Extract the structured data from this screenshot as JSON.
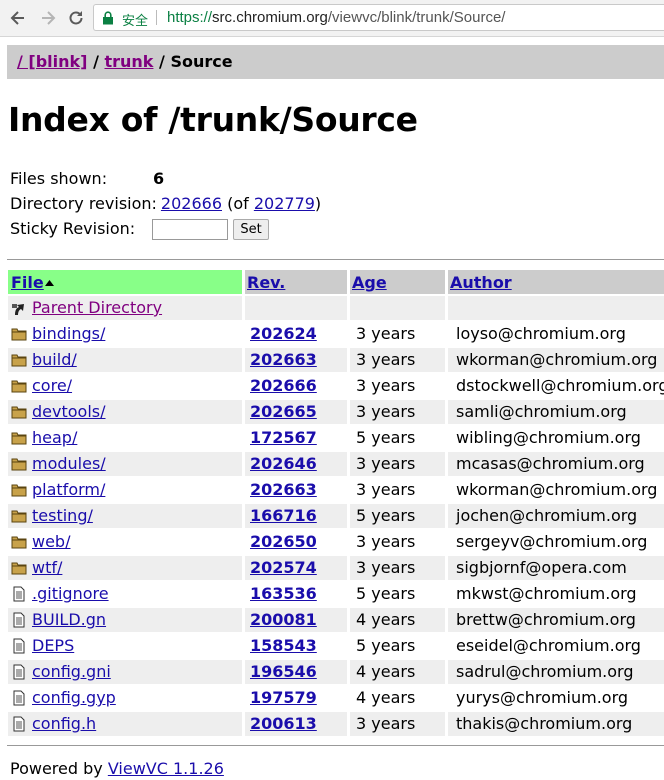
{
  "browser": {
    "secure_label": "安全",
    "url_scheme": "https://",
    "url_host": "src.chromium.org",
    "url_path": "/viewvc/blink/trunk/Source/"
  },
  "breadcrumb": {
    "root_label": "/ [blink]",
    "sep1": " / ",
    "trunk_label": "trunk",
    "sep2": " / ",
    "current": "Source"
  },
  "page_title": "Index of /trunk/Source",
  "info": {
    "files_shown_label": "Files shown:",
    "files_shown_value": "6",
    "dir_revision_label": "Directory revision:",
    "dir_revision": "202666",
    "of_open": " (of ",
    "head_revision": "202779",
    "of_close": ")",
    "sticky_label": "Sticky Revision:",
    "sticky_value": "",
    "set_button": "Set"
  },
  "table": {
    "headers": {
      "file": "File",
      "rev": "Rev.",
      "age": "Age",
      "author": "Author"
    },
    "parent_label": " Parent Directory",
    "rows": [
      {
        "name": " bindings/",
        "type": "dir",
        "rev": "202624",
        "age": "3 years",
        "author": "loyso@chromium.org"
      },
      {
        "name": " build/",
        "type": "dir",
        "rev": "202663",
        "age": "3 years",
        "author": "wkorman@chromium.org"
      },
      {
        "name": " core/",
        "type": "dir",
        "rev": "202666",
        "age": "3 years",
        "author": "dstockwell@chromium.org"
      },
      {
        "name": " devtools/",
        "type": "dir",
        "rev": "202665",
        "age": "3 years",
        "author": "samli@chromium.org"
      },
      {
        "name": " heap/",
        "type": "dir",
        "rev": "172567",
        "age": "5 years",
        "author": "wibling@chromium.org"
      },
      {
        "name": " modules/",
        "type": "dir",
        "rev": "202646",
        "age": "3 years",
        "author": "mcasas@chromium.org"
      },
      {
        "name": " platform/",
        "type": "dir",
        "rev": "202663",
        "age": "3 years",
        "author": "wkorman@chromium.org"
      },
      {
        "name": " testing/",
        "type": "dir",
        "rev": "166716",
        "age": "5 years",
        "author": "jochen@chromium.org"
      },
      {
        "name": " web/",
        "type": "dir",
        "rev": "202650",
        "age": "3 years",
        "author": "sergeyv@chromium.org"
      },
      {
        "name": " wtf/",
        "type": "dir",
        "rev": "202574",
        "age": "3 years",
        "author": "sigbjornf@opera.com"
      },
      {
        "name": " .gitignore",
        "type": "file",
        "rev": "163536",
        "age": "5 years",
        "author": "mkwst@chromium.org"
      },
      {
        "name": " BUILD.gn",
        "type": "file",
        "rev": "200081",
        "age": "4 years",
        "author": "brettw@chromium.org"
      },
      {
        "name": " DEPS",
        "type": "file",
        "rev": "158543",
        "age": "5 years",
        "author": "eseidel@chromium.org"
      },
      {
        "name": " config.gni",
        "type": "file",
        "rev": "196546",
        "age": "4 years",
        "author": "sadrul@chromium.org"
      },
      {
        "name": " config.gyp",
        "type": "file",
        "rev": "197579",
        "age": "4 years",
        "author": "yurys@chromium.org"
      },
      {
        "name": " config.h",
        "type": "file",
        "rev": "200613",
        "age": "3 years",
        "author": "thakis@chromium.org"
      }
    ]
  },
  "footer": {
    "prefix": "Powered by ",
    "link": "ViewVC 1.1.26"
  },
  "colors": {
    "link": "#1a0dab",
    "visited": "#800080",
    "sorted_header": "#88ff88",
    "header_bg": "#cccccc",
    "odd_row": "#eeeeee"
  },
  "icons": [
    "back-arrow-icon",
    "forward-arrow-icon",
    "reload-icon",
    "lock-icon",
    "parent-dir-icon",
    "folder-icon",
    "file-icon",
    "sort-ascending-icon"
  ]
}
